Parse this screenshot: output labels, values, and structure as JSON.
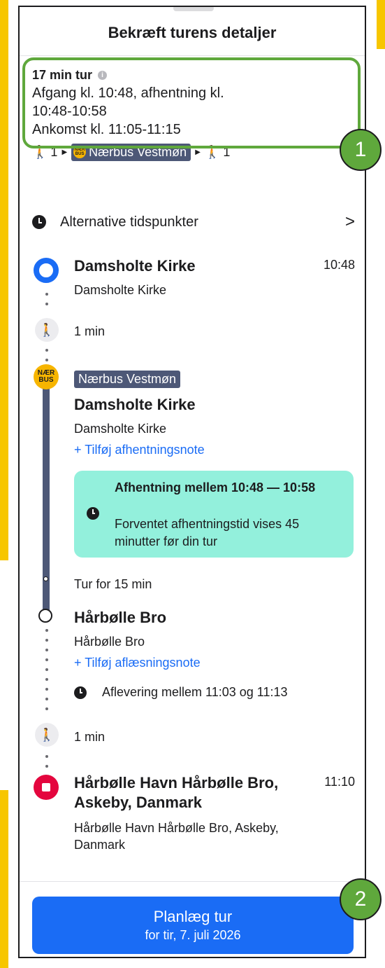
{
  "header": {
    "title": "Bekræft turens detaljer"
  },
  "summary": {
    "duration": "17 min tur",
    "info_icon": "i",
    "departure_line1": "Afgang kl. 10:48, afhentning kl.",
    "departure_line2": "10:48-10:58",
    "arrival": "Ankomst kl. 11:05-11:15",
    "legs": {
      "walk_before": "1",
      "line_name": "Nærbus Vestmøn",
      "walk_after": "1"
    }
  },
  "markers": {
    "m1": "1",
    "m2": "2"
  },
  "alternative": {
    "label": "Alternative tidspunkter",
    "chevron": ">"
  },
  "origin": {
    "title": "Damsholte Kirke",
    "subtitle": "Damsholte Kirke",
    "time": "10:48"
  },
  "walk1": {
    "duration": "1 min"
  },
  "bus": {
    "logo_line1": "NÆR",
    "logo_line2": "BUS",
    "line_name": "Nærbus Vestmøn",
    "stop_title": "Damsholte Kirke",
    "stop_subtitle": "Damsholte Kirke",
    "add_pickup_note": "+ Tilføj afhentningsnote",
    "notice_title": "Afhentning mellem 10:48 — 10:58",
    "notice_body": "Forventet afhentningstid vises 45 minutter før din tur",
    "ride_duration": "Tur for 15 min"
  },
  "dropoff": {
    "title": "Hårbølle Bro",
    "subtitle": "Hårbølle Bro",
    "add_dropoff_note": "+ Tilføj aflæsningsnote",
    "window": "Aflevering mellem 11:03 og 11:13"
  },
  "walk2": {
    "duration": "1 min"
  },
  "destination": {
    "title": "Hårbølle Havn Hårbølle Bro, Askeby, Danmark",
    "subtitle": "Hårbølle Havn Hårbølle Bro, Askeby, Danmark",
    "time": "11:10"
  },
  "footer": {
    "plan_label": "Planlæg tur",
    "plan_sub": "for tir, 7. juli 2026"
  },
  "colors": {
    "accent": "#1a6cf5",
    "bus_line": "#4d5877",
    "nb_yellow": "#f7b500",
    "notice_bg": "#93f0dc",
    "dest_red": "#e4063e",
    "highlight_green": "#5fa83c",
    "frame_yellow": "#f7c600"
  }
}
